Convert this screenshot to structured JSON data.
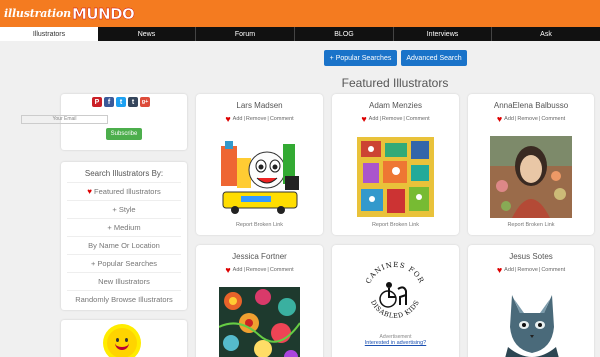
{
  "header": {
    "logo_part1": "illustration",
    "logo_part2": "MUNDO"
  },
  "nav": {
    "items": [
      {
        "label": "Illustrators",
        "active": true
      },
      {
        "label": "News"
      },
      {
        "label": "Forum"
      },
      {
        "label": "BLOG"
      },
      {
        "label": "Interviews"
      },
      {
        "label": "Ask"
      }
    ]
  },
  "top_buttons": {
    "popular": "+ Popular Searches",
    "advanced": "Advanced Search"
  },
  "page_title": "Featured Illustrators",
  "social": {
    "icons": [
      "P",
      "f",
      "t",
      "t",
      "g+"
    ],
    "email_placeholder": "Your Email",
    "subscribe": "Subscribe"
  },
  "search": {
    "title": "Search Illustrators By:",
    "items": [
      "Featured Illustrators",
      "+ Style",
      "+ Medium",
      "By Name Or Location",
      "+ Popular Searches",
      "New Illustrators",
      "Randomly Browse Illustrators"
    ]
  },
  "cards": [
    {
      "name": "Lars Madsen",
      "add": "Add",
      "remove": "Remove",
      "comment": "Comment",
      "broken": "Report Broken Link"
    },
    {
      "name": "Adam Menzies",
      "add": "Add",
      "remove": "Remove",
      "comment": "Comment",
      "broken": "Report Broken Link"
    },
    {
      "name": "AnnaElena Balbusso",
      "add": "Add",
      "remove": "Remove",
      "comment": "Comment",
      "broken": "Report Broken Link"
    },
    {
      "name": "Jessica Fortner",
      "add": "Add",
      "remove": "Remove",
      "comment": "Comment"
    },
    {
      "name": "Jesus Sotes",
      "add": "Add",
      "remove": "Remove",
      "comment": "Comment"
    }
  ],
  "ad": {
    "logo_text": "CANINES FOR DISABLED KIDS",
    "label": "Advertisement",
    "link": "Interested in advertising?"
  },
  "colors": {
    "header_orange": "#f47b20",
    "nav_black": "#111111",
    "button_blue": "#1a73c9",
    "subscribe_green": "#4cae4c",
    "heart_red": "#dd0000"
  }
}
